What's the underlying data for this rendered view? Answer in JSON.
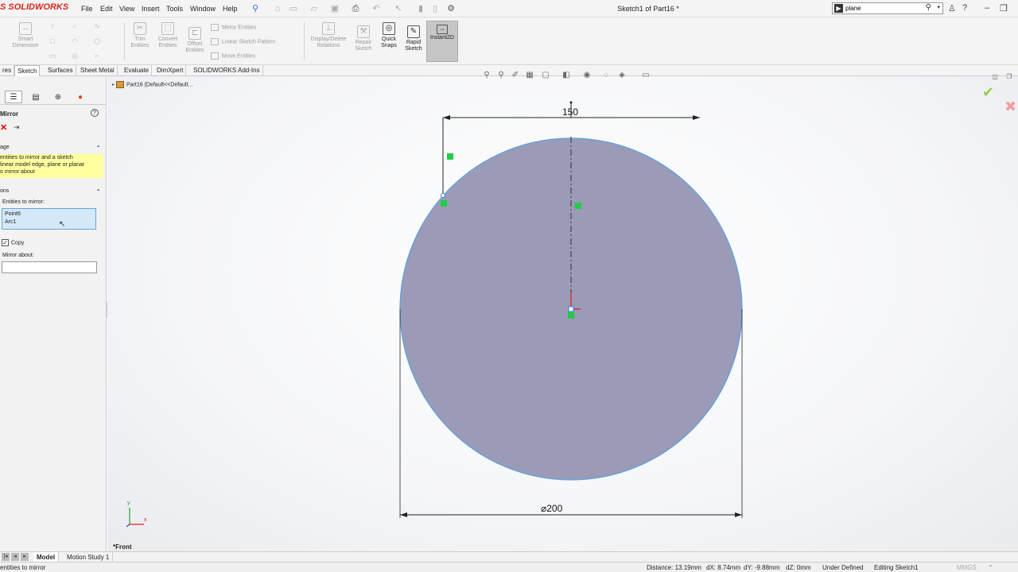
{
  "app": {
    "logo": "S SOLIDWORKS",
    "document_title": "Sketch1 of Part16 *"
  },
  "menu": [
    "File",
    "Edit",
    "View",
    "Insert",
    "Tools",
    "Window",
    "Help"
  ],
  "search": {
    "value": "plane"
  },
  "commands": {
    "smart_dimension": "Smart Dimension",
    "trim_entities": "Trim Entities",
    "convert_entities": "Convert Entities",
    "offset_entities": "Offset Entities",
    "mirror_entities": "Mirror Entities",
    "linear_sketch_pattern": "Linear Sketch Pattern",
    "move_entities": "Move Entities",
    "display_delete_relations": "Display/Delete Relations",
    "repair_sketch": "Repair Sketch",
    "quick_snaps": "Quick Snaps",
    "rapid_sketch": "Rapid Sketch",
    "instant2d": "Instant2D"
  },
  "tabs": [
    "res",
    "Sketch",
    "Surfaces",
    "Sheet Metal",
    "Evaluate",
    "DimXpert",
    "SOLIDWORKS Add-Ins"
  ],
  "property_manager": {
    "title": "Mirror",
    "message_header": "age",
    "message": [
      " entities to mirror and a sketch",
      "linear model edge, plane or planar",
      "o mirror about"
    ],
    "options_header": "ons",
    "entities_label": "Entities to mirror:",
    "entities": [
      "Point6",
      "Arc1"
    ],
    "copy_label": "Copy",
    "copy_checked": "✓",
    "mirror_about_label": "Mirror about:"
  },
  "tree": {
    "item": "Part16 (Default<<Default..."
  },
  "sketch": {
    "dim_top": "150",
    "dim_bottom": "⌀200",
    "view_name": "*Front",
    "triad_x": "x",
    "triad_y": "y"
  },
  "bottom_tabs": [
    "Model",
    "Motion Study 1"
  ],
  "status": {
    "prompt": "entities to mirror",
    "distance": "Distance: 13.19mm",
    "dx": "dX: 8.74mm",
    "dy": "dY: -9.88mm",
    "dz": "dZ: 0mm",
    "state": "Under Defined",
    "editing": "Editing Sketch1",
    "units": "MMGS"
  },
  "colors": {
    "circle_fill": "#9b9bb8",
    "circle_stroke": "#5aa0e0",
    "relation_green": "#22cc44",
    "logo_red": "#d8261c"
  }
}
